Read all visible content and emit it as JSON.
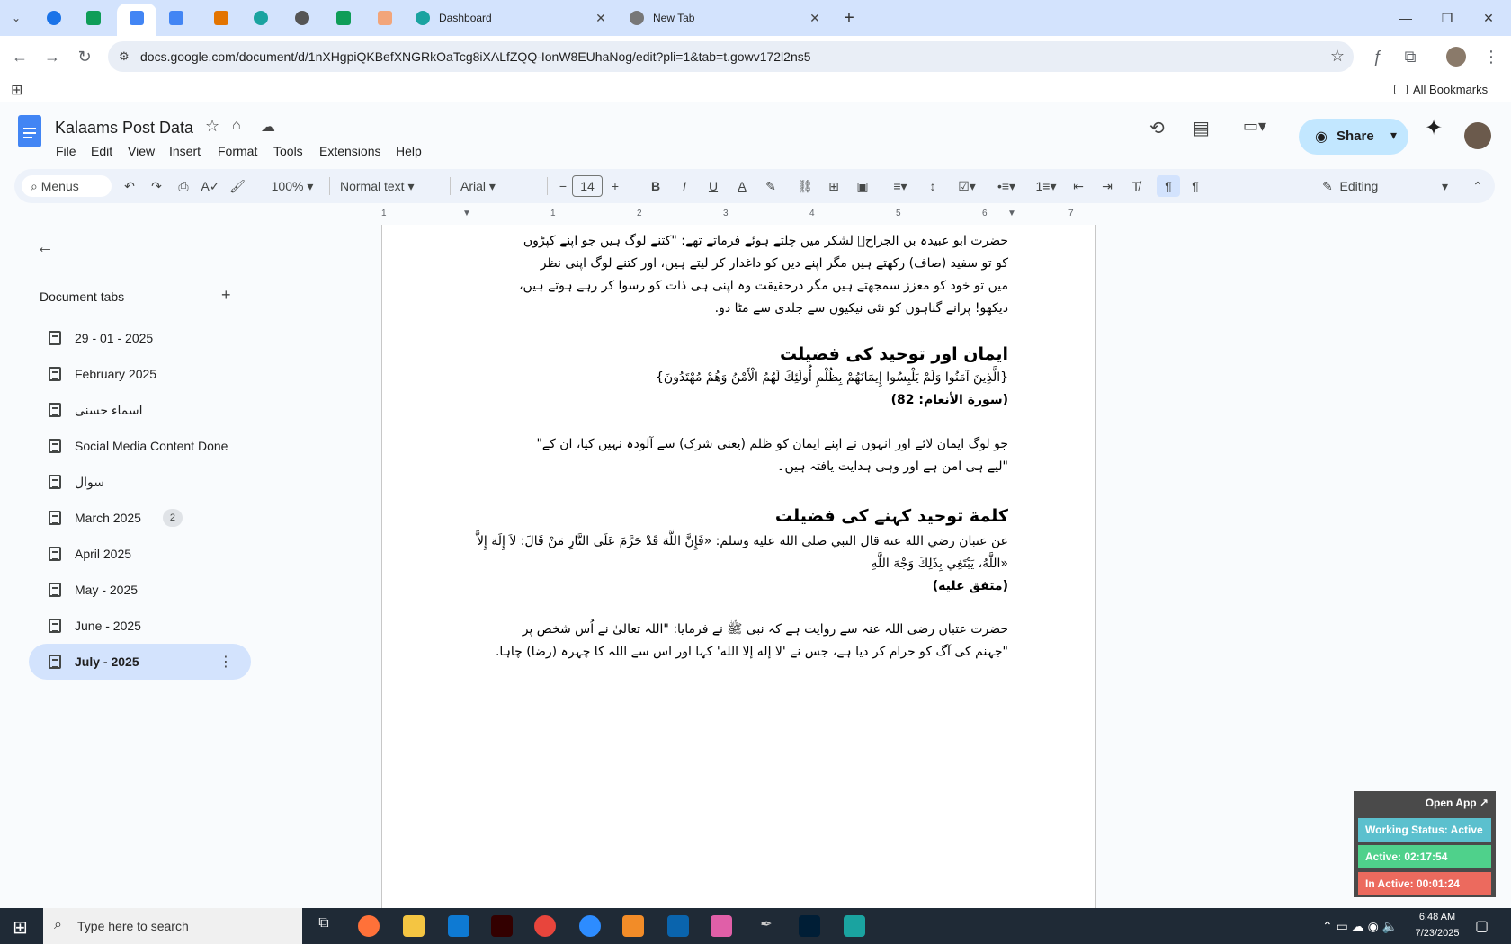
{
  "browser": {
    "tabs": [
      {
        "title": "Dashboard"
      },
      {
        "title": "New Tab"
      }
    ],
    "url": "docs.google.com/document/d/1nXHgpiQKBefXNGRkOaTcg8iXALfZQQ-IonW8EUhaNog/edit?pli=1&tab=t.gowv172l2ns5",
    "bookmarks_label": "All Bookmarks"
  },
  "doc": {
    "title": "Kalaams Post Data",
    "menu": [
      "File",
      "Edit",
      "View",
      "Insert",
      "Format",
      "Tools",
      "Extensions",
      "Help"
    ],
    "share_label": "Share"
  },
  "toolbar": {
    "menus_label": "Menus",
    "zoom": "100%",
    "style": "Normal text",
    "font": "Arial",
    "font_size": "14",
    "mode": "Editing"
  },
  "ruler": [
    "1",
    "1",
    "2",
    "3",
    "4",
    "5",
    "6",
    "7"
  ],
  "sidebar": {
    "title": "Document tabs",
    "tabs": [
      {
        "label": "29 - 01 - 2025"
      },
      {
        "label": "February 2025"
      },
      {
        "label": "اسماء حسنی"
      },
      {
        "label": "Social Media Content Done"
      },
      {
        "label": "سوال"
      },
      {
        "label": "March 2025",
        "badge": "2"
      },
      {
        "label": "April 2025"
      },
      {
        "label": "May - 2025"
      },
      {
        "label": "June - 2025"
      },
      {
        "label": "July - 2025"
      }
    ]
  },
  "content": {
    "para1": [
      "حضرت ابو عبیدہ بن الجراحؓ لشکر میں چلتے ہوئے فرماتے تھے: \"کتنے لوگ ہیں جو اپنے کپڑوں",
      "کو تو سفید (صاف) رکھتے ہیں مگر اپنے دین کو داغدار کر لیتے ہیں، اور کتنے لوگ اپنی نظر",
      "میں تو خود کو معزز سمجھتے ہیں مگر درحقیقت وہ اپنی ہی ذات کو رسوا کر رہے ہوتے ہیں،",
      "دیکھو! پرانے گناہوں کو نئی نیکیوں سے جلدی سے مٹا دو."
    ],
    "heading1": "ایمان اور توحید کی فضیلت",
    "ayah": "{الَّذِينَ آمَنُوا وَلَمْ يَلْبِسُوا إِيمَانَهُمْ بِظُلْمٍ أُولَئِكَ لَهُمُ الْأَمْنُ وَهُمْ مُهْتَدُونَ}",
    "ayah_ref": "(سورة الأنعام: 82)",
    "para2": [
      "جو لوگ ایمان لائے اور انہوں نے اپنے ایمان کو ظلم (یعنی شرک) سے آلودہ نہیں کیا، ان کے\"",
      "\"لیے ہی امن ہے اور وہی ہدایت یافتہ ہیں۔"
    ],
    "heading2": "کلمة توحید کہنے کی فضیلت",
    "hadith": [
      "عن عتبان رضي الله عنه قال النبي صلى الله عليه وسلم: «فَإِنَّ اللَّهَ قَدْ حَرَّمَ عَلَى النَّارِ مَنْ قَالَ: لاَ إِلَهَ إِلاَّ",
      "«اللَّهُ، يَبْتَغِي بِذَلِكَ وَجْهَ اللَّهِ"
    ],
    "hadith_ref": "(متفق علیه)",
    "para3": [
      "حضرت عتبان رضی اللہ عنہ سے روایت ہے کہ نبی ﷺ نے فرمایا: \"اللہ تعالیٰ نے اُس شخص پر",
      "\"جہنم کی آگ کو حرام کر دیا ہے، جس نے 'لا إله إلا الله' کہا اور اس سے اللہ کا چہرہ (رضا) چاہا."
    ]
  },
  "status_widget": {
    "open_app": "Open App ↗",
    "working_status": "Working Status: Active",
    "active": "Active: 02:17:54",
    "inactive": "In Active: 00:01:24"
  },
  "taskbar": {
    "search_placeholder": "Type here to search",
    "time": "6:48 AM",
    "date": "7/23/2025"
  },
  "colors": {
    "tabstrip": "#d3e3fd",
    "share": "#c2e7ff",
    "active_tab": "#d3e3fd",
    "status_working": "#5bc0ce",
    "status_active": "#4fd18b",
    "status_inactive": "#ec6a5e"
  }
}
